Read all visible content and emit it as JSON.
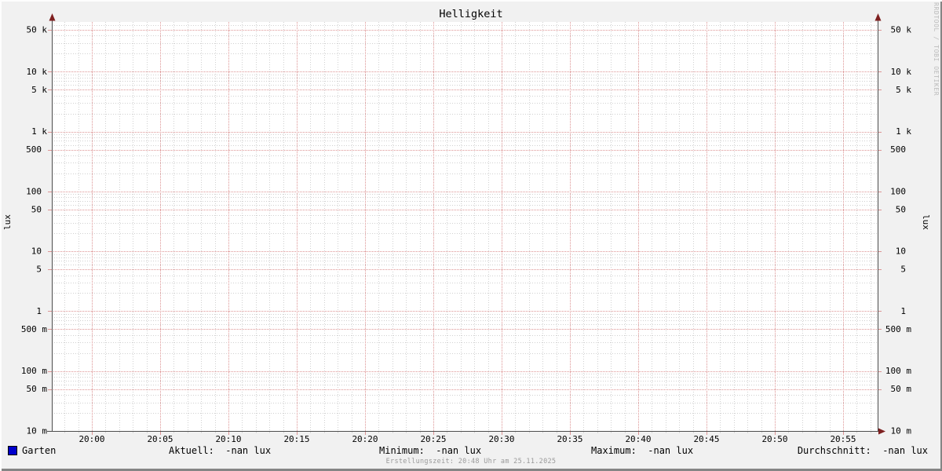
{
  "title": "Helligkeit",
  "watermark": "RRDTOOL / TOBI OETIKER",
  "footer": "Erstellungszeit: 20:48 Uhr am 25.11.2025",
  "y_axis_label": "lux",
  "legend": {
    "series": {
      "label": "Garten",
      "color": "#0000cc"
    },
    "stats": [
      {
        "name": "aktuell",
        "text": "Aktuell:  -nan lux"
      },
      {
        "name": "minimum",
        "text": "Minimum:  -nan lux"
      },
      {
        "name": "maximum",
        "text": "Maximum:  -nan lux"
      },
      {
        "name": "durchschnitt",
        "text": "Durchschnitt:  -nan lux"
      }
    ]
  },
  "chart_data": {
    "type": "line",
    "title": "Helligkeit",
    "ylabel": "lux",
    "y_scale": "log",
    "y_range": [
      0.01,
      67000
    ],
    "x_range": [
      "19:57",
      "20:58"
    ],
    "grid": true,
    "x_ticks": [
      {
        "minute": 0,
        "label": "20:00"
      },
      {
        "minute": 5,
        "label": "20:05"
      },
      {
        "minute": 10,
        "label": "20:10"
      },
      {
        "minute": 15,
        "label": "20:15"
      },
      {
        "minute": 20,
        "label": "20:20"
      },
      {
        "minute": 25,
        "label": "20:25"
      },
      {
        "minute": 30,
        "label": "20:30"
      },
      {
        "minute": 35,
        "label": "20:35"
      },
      {
        "minute": 40,
        "label": "20:40"
      },
      {
        "minute": 45,
        "label": "20:45"
      },
      {
        "minute": 50,
        "label": "20:50"
      },
      {
        "minute": 55,
        "label": "20:55"
      }
    ],
    "y_ticks": [
      {
        "value": 0.01,
        "label": "10 m"
      },
      {
        "value": 0.05,
        "label": "50 m"
      },
      {
        "value": 0.1,
        "label": "100 m"
      },
      {
        "value": 0.5,
        "label": "500 m"
      },
      {
        "value": 1,
        "label": "1"
      },
      {
        "value": 5,
        "label": "5"
      },
      {
        "value": 10,
        "label": "10"
      },
      {
        "value": 50,
        "label": "50"
      },
      {
        "value": 100,
        "label": "100"
      },
      {
        "value": 500,
        "label": "500"
      },
      {
        "value": 1000,
        "label": "1 k"
      },
      {
        "value": 5000,
        "label": "5 k"
      },
      {
        "value": 10000,
        "label": "10 k"
      },
      {
        "value": 50000,
        "label": "50 k"
      }
    ],
    "series": [
      {
        "name": "Garten",
        "color": "#0000cc",
        "values": []
      }
    ],
    "stats": {
      "aktuell": "-nan lux",
      "minimum": "-nan lux",
      "maximum": "-nan lux",
      "durchschnitt": "-nan lux"
    }
  },
  "colors": {
    "background": "#f1f1f1",
    "canvas": "#ffffff",
    "grid_minor": "#d0d0d0",
    "grid_major": "#dd9494",
    "axis": "#4d4d4d",
    "arrow": "#7e2020",
    "text": "#000000",
    "watermark": "#bcbcbc",
    "footer_text": "#9a9a9a",
    "series_garten": "#0000cc"
  }
}
